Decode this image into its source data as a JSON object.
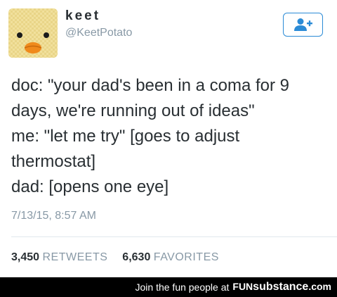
{
  "user": {
    "display_name": "keet",
    "handle": "@KeetPotato",
    "avatar_icon": "duck-face-avatar"
  },
  "follow_button": {
    "icon": "add-user-icon",
    "accent": "#2b8bd6"
  },
  "tweet": {
    "lines": [
      "doc: \"your dad's been in a coma for 9",
      "days, we're running out of ideas\"",
      "me: \"let me try\" [goes to adjust",
      "thermostat]",
      "dad: [opens one eye]"
    ],
    "timestamp": "7/13/15, 8:57 AM"
  },
  "stats": {
    "retweets_count": "3,450",
    "retweets_label": "RETWEETS",
    "favorites_count": "6,630",
    "favorites_label": "FAVORITES"
  },
  "footer": {
    "text": "Join the fun people at",
    "brand_fun": "FUN",
    "brand_substance": "substance",
    "brand_com": ".com"
  },
  "colors": {
    "text": "#292f33",
    "muted": "#8899a6",
    "divider": "#e1e8ed",
    "footer_bg": "#000000"
  }
}
